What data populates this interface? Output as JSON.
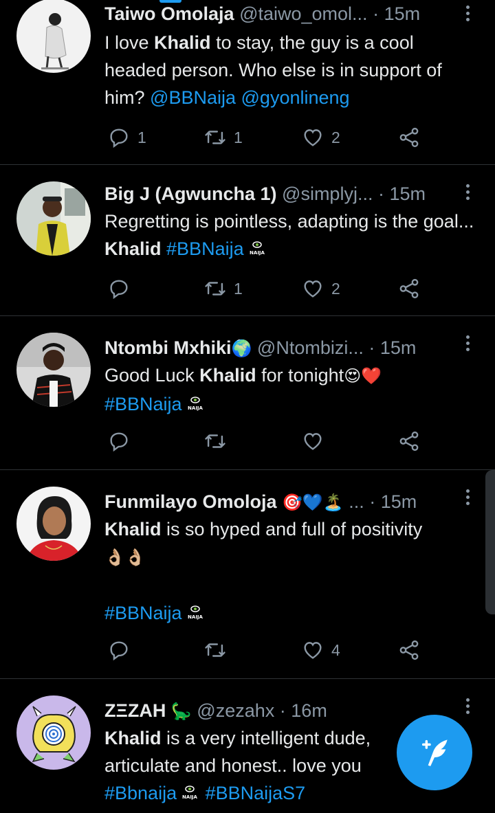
{
  "tweets": [
    {
      "name": "Taiwo Omolaja",
      "name_emoji": "",
      "handle": "@taiwo_omol...",
      "time": "15m",
      "text_parts": [
        "I love ",
        "Khalid",
        " to stay, the guy is a cool headed person. Who else is in support of him? ",
        "@BBNaija",
        " ",
        "@gyonlineng"
      ],
      "replies": "1",
      "retweets": "1",
      "likes": "2"
    },
    {
      "name": "Big J (Agwuncha 1)",
      "handle": "@simplyj...",
      "time": "15m",
      "text_parts": [
        "Regretting is pointless, adapting is the goal... ",
        "Khalid",
        " ",
        "#BBNaija"
      ],
      "replies": "",
      "retweets": "1",
      "likes": "2"
    },
    {
      "name": "Ntombi Mxhiki",
      "name_emoji": "🌍",
      "handle": "@Ntombizi...",
      "time": "15m",
      "text_parts": [
        "Good Luck ",
        "Khalid",
        " for tonight",
        "😍❤️",
        "#BBNaija"
      ],
      "replies": "",
      "retweets": "",
      "likes": ""
    },
    {
      "name": "Funmilayo Omoloja",
      "name_emoji": "🎯💙🏝️",
      "handle": "...",
      "time": "15m",
      "text_parts": [
        "Khalid",
        " is so hyped and full of positivity",
        "👌🏼👌🏼",
        "#BBNaija"
      ],
      "replies": "",
      "retweets": "",
      "likes": "4"
    },
    {
      "name": "ZΞZAH",
      "name_emoji": "🦕",
      "handle": "@zezahx",
      "time": "16m",
      "text_parts": [
        "Khalid",
        " is a very intelligent dude, articulate and honest.. love you",
        "#Bbnaija",
        "#BBNaijaS7"
      ]
    }
  ],
  "dot": "·",
  "logo_text": "NAIJA",
  "icons": {
    "reply": "reply-icon",
    "retweet": "retweet-icon",
    "like": "heart-icon",
    "share": "share-icon",
    "more": "more-vertical-icon",
    "compose": "compose-tweet-icon"
  },
  "colors": {
    "accent": "#1d9bf0",
    "muted": "#8b98a5",
    "background": "#000000",
    "divider": "#2f3336"
  }
}
